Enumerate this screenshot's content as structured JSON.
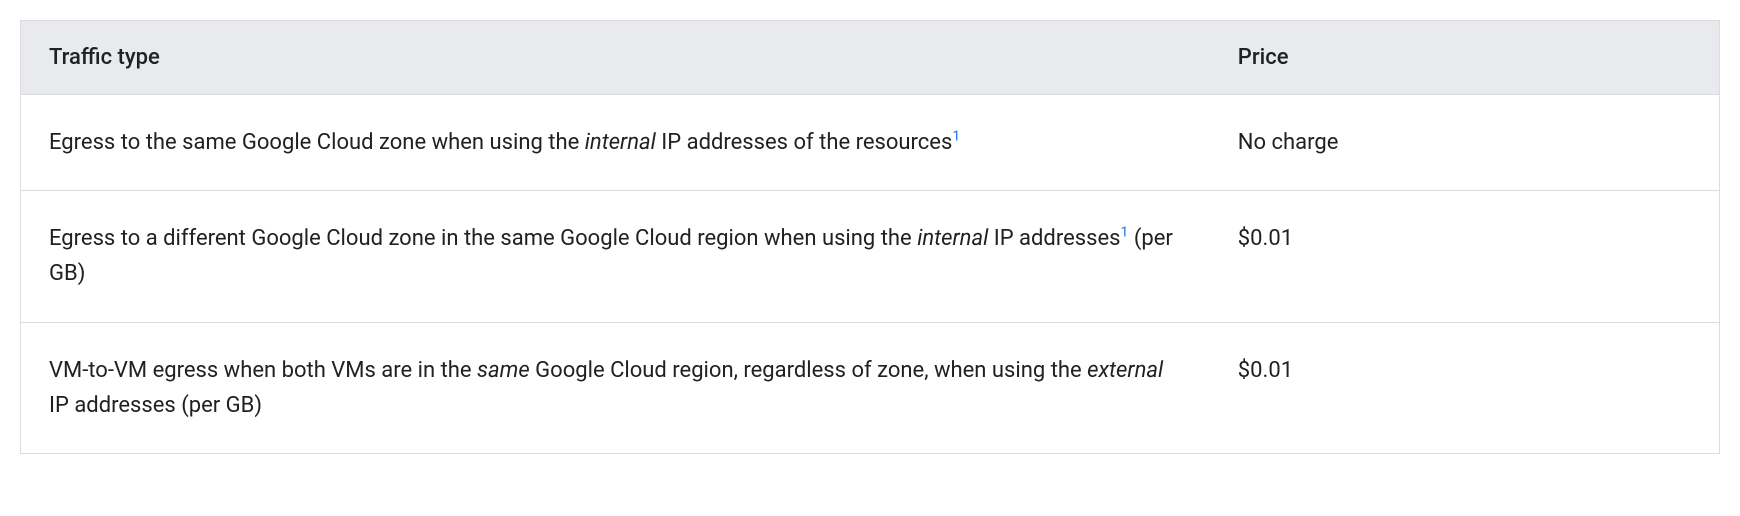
{
  "table": {
    "headers": {
      "col1": "Traffic type",
      "col2": "Price"
    },
    "rows": [
      {
        "desc_part1": "Egress to the same Google Cloud zone when using the ",
        "desc_em1": "internal",
        "desc_part2": " IP addresses of the resources",
        "footnote1": "1",
        "desc_part3": "",
        "desc_em2": "",
        "desc_part4": "",
        "price": "No charge"
      },
      {
        "desc_part1": "Egress to a different Google Cloud zone in the same Google Cloud region when using the ",
        "desc_em1": "internal",
        "desc_part2": " IP addresses",
        "footnote1": "1",
        "desc_part3": " (per GB)",
        "desc_em2": "",
        "desc_part4": "",
        "price": "$0.01"
      },
      {
        "desc_part1": "VM-to-VM egress when both VMs are in the ",
        "desc_em1": "same",
        "desc_part2": " Google Cloud region, regardless of zone, when using the ",
        "footnote1": "",
        "desc_part3": "",
        "desc_em2": "external",
        "desc_part4": " IP addresses (per GB)",
        "price": "$0.01"
      }
    ]
  }
}
